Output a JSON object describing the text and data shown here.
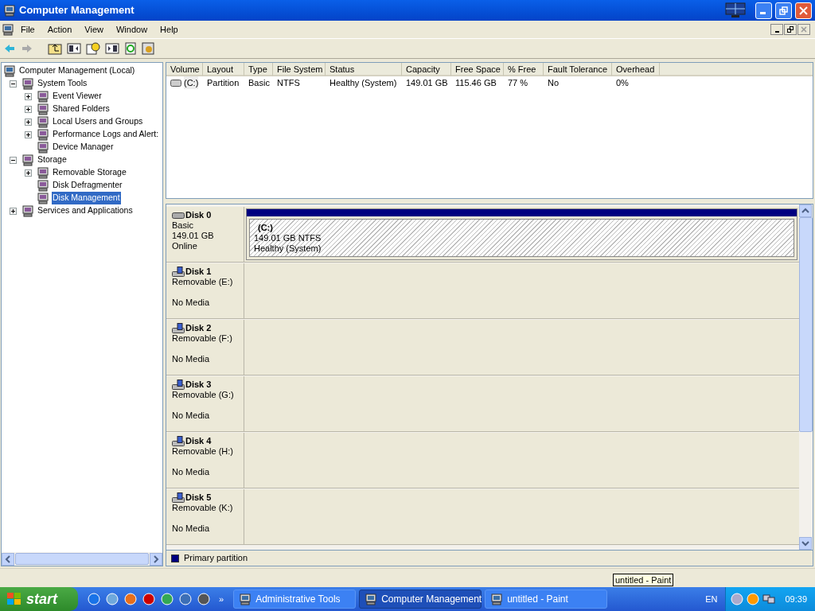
{
  "window": {
    "title": "Computer Management"
  },
  "menu": [
    "File",
    "Action",
    "View",
    "Window",
    "Help"
  ],
  "tree": [
    {
      "label": "Computer Management (Local)",
      "kind": "root",
      "selected": false,
      "children": [
        {
          "label": "System Tools",
          "kind": "branch",
          "expanded": true,
          "selected": false,
          "children": [
            {
              "label": "Event Viewer",
              "kind": "branch",
              "expanded": false,
              "selected": false
            },
            {
              "label": "Shared Folders",
              "kind": "branch",
              "expanded": false,
              "selected": false
            },
            {
              "label": "Local Users and Groups",
              "kind": "branch",
              "expanded": false,
              "selected": false
            },
            {
              "label": "Performance Logs and Alert:",
              "kind": "branch",
              "expanded": false,
              "selected": false
            },
            {
              "label": "Device Manager",
              "kind": "leaf",
              "selected": false
            }
          ]
        },
        {
          "label": "Storage",
          "kind": "branch",
          "expanded": true,
          "selected": false,
          "children": [
            {
              "label": "Removable Storage",
              "kind": "branch",
              "expanded": false,
              "selected": false
            },
            {
              "label": "Disk Defragmenter",
              "kind": "leaf",
              "selected": false
            },
            {
              "label": "Disk Management",
              "kind": "leaf",
              "selected": true
            }
          ]
        },
        {
          "label": "Services and Applications",
          "kind": "branch",
          "expanded": false,
          "selected": false
        }
      ]
    }
  ],
  "table": {
    "columns": [
      "Volume",
      "Layout",
      "Type",
      "File System",
      "Status",
      "Capacity",
      "Free Space",
      "% Free",
      "Fault Tolerance",
      "Overhead"
    ],
    "rows": [
      [
        "(C:)",
        "Partition",
        "Basic",
        "NTFS",
        "Healthy (System)",
        "149.01 GB",
        "115.46 GB",
        "77 %",
        "No",
        "0%"
      ]
    ]
  },
  "disks": [
    {
      "name": "Disk 0",
      "kind": "basic",
      "lines": [
        "Basic",
        "149.01 GB",
        "Online"
      ],
      "partition": {
        "label": "(C:)",
        "size": "149.01 GB NTFS",
        "status": "Healthy (System)"
      }
    },
    {
      "name": "Disk 1",
      "kind": "removable",
      "lines": [
        "Removable (E:)",
        "No Media"
      ]
    },
    {
      "name": "Disk 2",
      "kind": "removable",
      "lines": [
        "Removable (F:)",
        "No Media"
      ]
    },
    {
      "name": "Disk 3",
      "kind": "removable",
      "lines": [
        "Removable (G:)",
        "No Media"
      ]
    },
    {
      "name": "Disk 4",
      "kind": "removable",
      "lines": [
        "Removable (H:)",
        "No Media"
      ]
    },
    {
      "name": "Disk 5",
      "kind": "removable",
      "lines": [
        "Removable (K:)",
        "No Media"
      ]
    }
  ],
  "legend": [
    {
      "label": "Primary partition",
      "color": "#000080"
    }
  ],
  "tooltip": "untitled - Paint",
  "taskbar": {
    "start": "start",
    "more": "»",
    "tasks": [
      {
        "label": "Administrative Tools",
        "selected": false
      },
      {
        "label": "Computer Management",
        "selected": true
      },
      {
        "label": "untitled - Paint",
        "selected": false
      }
    ],
    "language": "EN",
    "clock": "09:39"
  }
}
